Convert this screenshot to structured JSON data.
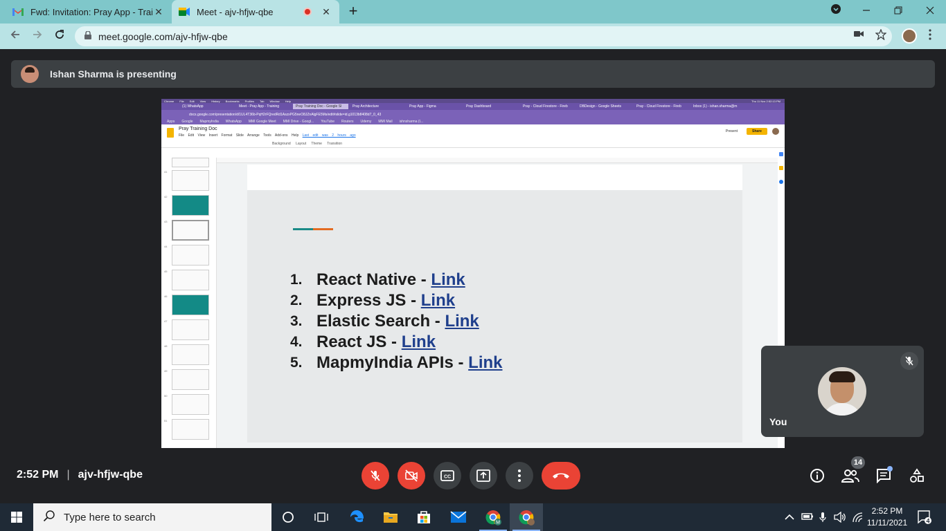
{
  "browser": {
    "tabs": [
      {
        "title": "Fwd: Invitation: Pray App - Trainin",
        "active": false
      },
      {
        "title": "Meet - ajv-hfjw-qbe",
        "active": true
      }
    ],
    "url": "meet.google.com/ajv-hfjw-qbe",
    "new_tab_symbol": "+",
    "close_symbol": "✕"
  },
  "meet": {
    "presenter_text": "Ishan Sharma is presenting",
    "time": "2:52 PM",
    "separator": "|",
    "meeting_code": "ajv-hfjw-qbe",
    "self_label": "You",
    "participant_count": "14",
    "controls": [
      "mic-off",
      "camera-off",
      "captions",
      "present-now",
      "more-options",
      "leave-call"
    ],
    "side_controls": [
      "meeting-details",
      "people",
      "chat",
      "activities"
    ]
  },
  "shared_screen": {
    "mac_menu": [
      "Chrome",
      "File",
      "Edit",
      "View",
      "History",
      "Bookmarks",
      "Profiles",
      "Tab",
      "Window",
      "Help"
    ],
    "mac_clock": "Thu 11 Nov 2:52:13 PM",
    "inner_tabs": [
      {
        "title": "(1) WhatsApp",
        "active": false
      },
      {
        "title": "Meet - Pray App - Training",
        "active": false
      },
      {
        "title": "Pray Training Doc - Google Sl",
        "active": true
      },
      {
        "title": "Pray Architecture",
        "active": false
      },
      {
        "title": "Pray App - Figma",
        "active": false
      },
      {
        "title": "Pray Dashboard",
        "active": false
      },
      {
        "title": "Pray - Cloud Firestore - Fireb",
        "active": false
      },
      {
        "title": "DBDesign - Google Sheets",
        "active": false
      },
      {
        "title": "Pray - Cloud Firestore - Fireb",
        "active": false
      },
      {
        "title": "Inbox (1) - ishan.sharma@m",
        "active": false
      }
    ],
    "inner_url": "docs.google.com/presentation/d/1UL4T36b-PqH2rFQredRd1AszxPG5neO8JZnAlgFE5Ms/edit#slide=id.g1013b8408d7_0_43",
    "bookmarks": [
      "Apps",
      "Google",
      "MapmyIndia",
      "WhatsApp",
      "MMI Google Meet",
      "MMI Drive - Googl...",
      "YouTube",
      "Routers",
      "Udemy",
      "MMI Mail",
      "ishnsharma (I..."
    ],
    "doc_title": "Pray Training Doc",
    "doc_menu": [
      "File",
      "Edit",
      "View",
      "Insert",
      "Format",
      "Slide",
      "Arrange",
      "Tools",
      "Add-ons",
      "Help"
    ],
    "last_edit": "Last edit was 2 hours ago",
    "toolbar_labels": [
      "Background",
      "Layout",
      "Theme",
      "Transition"
    ],
    "present_label": "Present",
    "share_label": "Share",
    "slide_numbers": [
      "41",
      "42",
      "43",
      "44",
      "45",
      "46",
      "47",
      "48",
      "49",
      "50",
      "51"
    ],
    "slide_items": [
      {
        "num": "1.",
        "text": "React Native",
        "dash": " - ",
        "link": "Link"
      },
      {
        "num": "2.",
        "text": "Express JS",
        "dash": " - ",
        "link": "Link"
      },
      {
        "num": "3.",
        "text": "Elastic Search",
        "dash": " - ",
        "link": "Link"
      },
      {
        "num": "4.",
        "text": "React JS",
        "dash": " - ",
        "link": "Link"
      },
      {
        "num": "5.",
        "text": "MapmyIndia APIs",
        "dash": " - ",
        "link": "Link"
      }
    ]
  },
  "taskbar": {
    "search_placeholder": "Type here to search",
    "time": "2:52 PM",
    "date": "11/11/2021",
    "notifications": "4",
    "pinned": [
      "cortana",
      "task-view",
      "edge",
      "file-explorer",
      "store",
      "mail",
      "chrome-profile-m",
      "chrome"
    ]
  },
  "colors": {
    "chrome_frame": "#7fc7ca",
    "chrome_toolbar": "#b9e3e5",
    "meet_bg": "#202124",
    "meet_red": "#ea4335",
    "link_blue": "#1f3f8c",
    "slide_teal": "#138a86",
    "slide_orange": "#e36b21"
  }
}
